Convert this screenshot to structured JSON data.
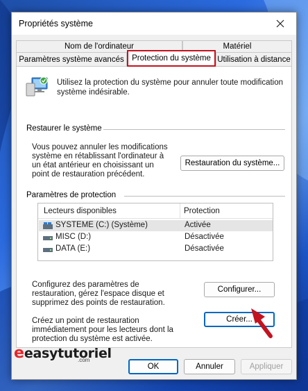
{
  "window": {
    "title": "Propriétés système"
  },
  "tabs": {
    "row1": [
      "Nom de l'ordinateur",
      "Matériel"
    ],
    "row2": [
      "Paramètres système avancés",
      "Protection du système",
      "Utilisation à distance"
    ],
    "active": "Protection du système"
  },
  "intro": "Utilisez la protection du système pour annuler toute modification système indésirable.",
  "restore": {
    "section_title": "Restaurer le système",
    "description": "Vous pouvez annuler les modifications système en rétablissant l'ordinateur à un état antérieur en choisissant un point de restauration précédent.",
    "button": "Restauration du système..."
  },
  "protection": {
    "section_title": "Paramètres de protection",
    "columns": [
      "Lecteurs disponibles",
      "Protection"
    ],
    "drives": [
      {
        "name": "SYSTEME (C:) (Système)",
        "status": "Activée",
        "icon": "system-drive-icon"
      },
      {
        "name": "MISC (D:)",
        "status": "Désactivée",
        "icon": "drive-icon"
      },
      {
        "name": "DATA (E:)",
        "status": "Désactivée",
        "icon": "drive-icon"
      }
    ],
    "configure_text": "Configurez des paramètres de restauration, gérez l'espace disque et supprimez des points de restauration.",
    "configure_button": "Configurer...",
    "create_text": "Créez un point de restauration immédiatement pour les lecteurs dont la protection du système est activée.",
    "create_button": "Créer..."
  },
  "footer": {
    "ok": "OK",
    "cancel": "Annuler",
    "apply": "Appliquer"
  },
  "watermark": {
    "brand": "easytutoriel",
    "sub": ".com"
  },
  "colors": {
    "tab_highlight": "#c3131f",
    "focus": "#0067c0",
    "arrow": "#c3131f"
  }
}
